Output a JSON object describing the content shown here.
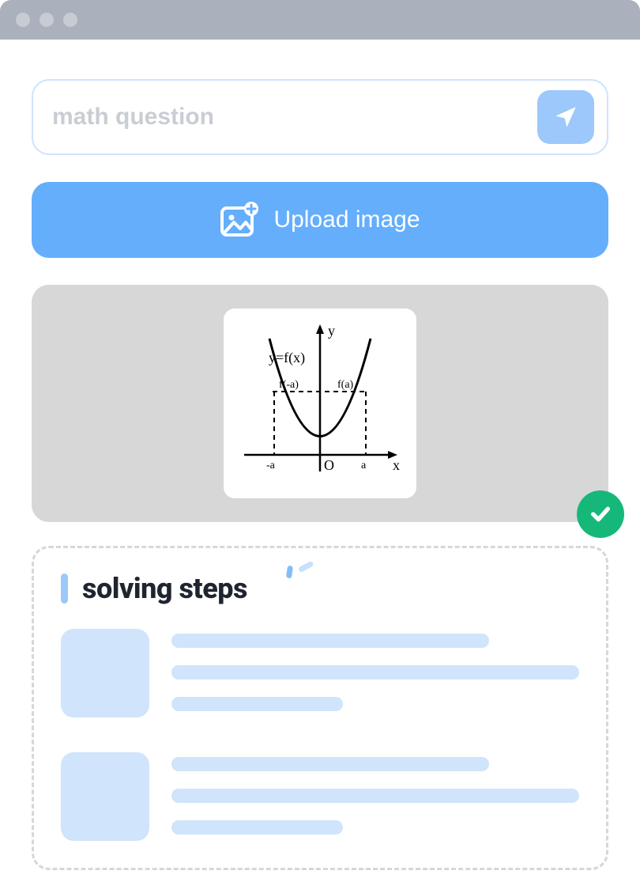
{
  "search": {
    "placeholder": "math question",
    "value": ""
  },
  "upload": {
    "label": "Upload image"
  },
  "preview": {
    "graph": {
      "y_axis_label": "y",
      "x_axis_label": "x",
      "origin_label": "O",
      "function_label": "y=f(x)",
      "left_value_label": "f(-a)",
      "right_value_label": "f(a)",
      "left_tick_label": "-a",
      "right_tick_label": "a"
    },
    "status": "success"
  },
  "steps": {
    "title": "solving steps"
  }
}
